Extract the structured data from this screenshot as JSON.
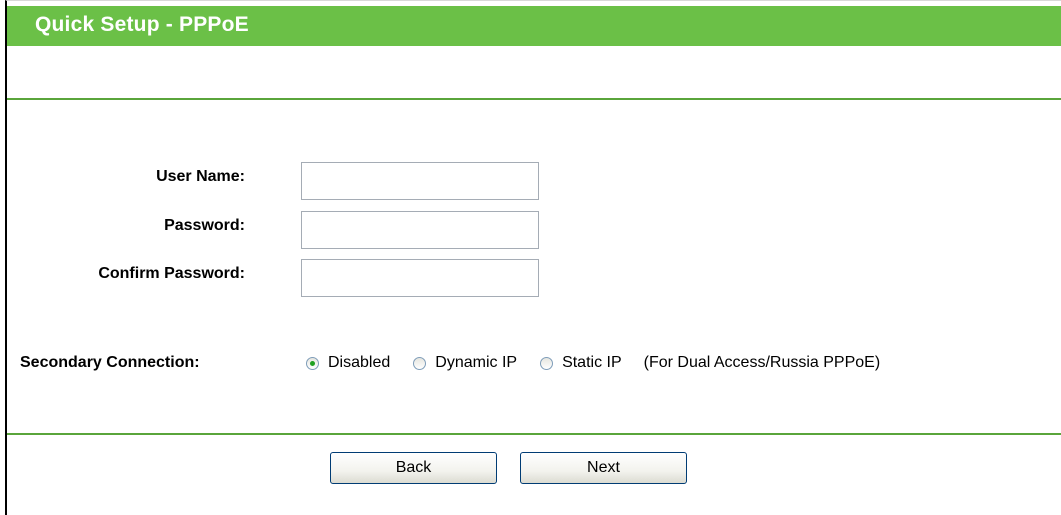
{
  "header": {
    "title": "Quick Setup - PPPoE"
  },
  "form": {
    "user_name": {
      "label": "User Name:",
      "value": "",
      "placeholder": ""
    },
    "password": {
      "label": "Password:",
      "value": "",
      "placeholder": ""
    },
    "confirm_password": {
      "label": "Confirm Password:",
      "value": "",
      "placeholder": ""
    },
    "secondary_connection": {
      "label": "Secondary Connection:",
      "options": [
        {
          "label": "Disabled",
          "selected": true
        },
        {
          "label": "Dynamic IP",
          "selected": false
        },
        {
          "label": "Static IP",
          "selected": false
        }
      ],
      "note": "(For Dual Access/Russia PPPoE)"
    }
  },
  "buttons": {
    "back_label": "Back",
    "next_label": "Next"
  },
  "colors": {
    "title_bar": "#6bc047",
    "divider": "#5aa53b",
    "radio_dot": "#21a121"
  }
}
